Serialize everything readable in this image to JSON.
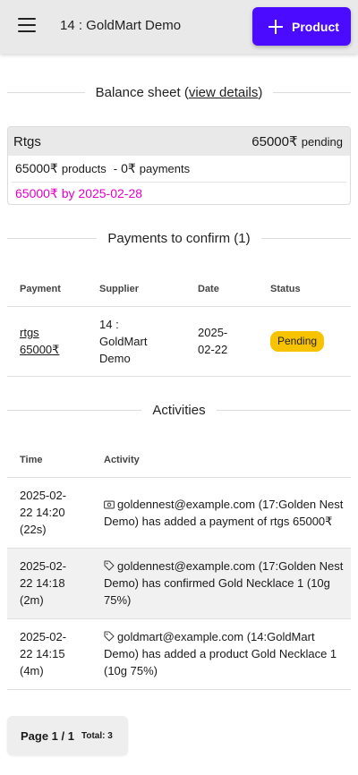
{
  "header": {
    "title": "14 : GoldMart Demo",
    "add_button_label": "Product"
  },
  "balance_sheet": {
    "heading_prefix": "Balance sheet (",
    "link_label": "view details",
    "heading_suffix": ")",
    "card": {
      "method": "Rtgs",
      "pending_amount": "65000₹",
      "pending_label": "pending",
      "products_amount": "65000₹",
      "products_label": "products",
      "separator": "-",
      "payments_amount": "0₹",
      "payments_label": "payments",
      "due": "65000₹ by 2025-02-28"
    }
  },
  "payments": {
    "heading": "Payments to confirm (1)",
    "columns": [
      "Payment",
      "Supplier",
      "Date",
      "Status"
    ],
    "rows": [
      {
        "payment_line1": "rtgs",
        "payment_line2": "65000₹",
        "supplier": "14 : GoldMart Demo",
        "date": "2025-02-22",
        "status": "Pending"
      }
    ]
  },
  "activities": {
    "heading": "Activities",
    "columns": [
      "Time",
      "Activity"
    ],
    "rows": [
      {
        "time": "2025-02-22 14:20 (22s)",
        "icon": "cash-icon",
        "text": "goldennest@example.com (17:Golden Nest Demo) has added a payment of rtgs 65000₹"
      },
      {
        "time": "2025-02-22 14:18 (2m)",
        "icon": "tag-icon",
        "text": "goldennest@example.com (17:Golden Nest Demo) has confirmed Gold Necklace 1 (10g 75%)"
      },
      {
        "time": "2025-02-22 14:15 (4m)",
        "icon": "tag-icon",
        "text": "goldmart@example.com (14:GoldMart Demo) has added a product Gold Necklace 1 (10g 75%)"
      }
    ]
  },
  "pagination": {
    "page": "Page 1 / 1",
    "total": "Total: 3"
  },
  "colors": {
    "accent": "#4b0bff",
    "due_text": "#e600c7",
    "pending_badge": "#f7c200"
  }
}
